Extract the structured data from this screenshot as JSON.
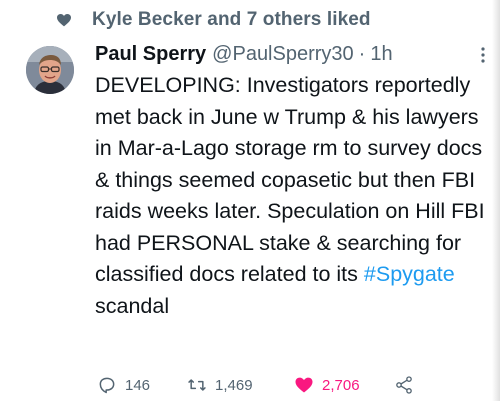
{
  "social_context": {
    "text": "Kyle Becker and 7 others liked",
    "icon": "heart-icon"
  },
  "author": {
    "display_name": "Paul Sperry",
    "handle": "@PaulSperry30",
    "separator": "·",
    "time": "1h"
  },
  "tweet": {
    "text_before_hashtag": "DEVELOPING: Investigators reportedly met back in June w Trump & his lawyers in Mar-a-Lago storage rm to survey docs & things seemed copasetic but then FBI raids weeks later. Speculation on Hill FBI had PERSONAL stake & searching for classified docs related to its ",
    "hashtag": "#Spygate",
    "text_after_hashtag": " scandal"
  },
  "actions": {
    "reply_count": "146",
    "retweet_count": "1,469",
    "like_count": "2,706"
  },
  "colors": {
    "like_pink": "#f91880",
    "link_blue": "#1d9bf0",
    "secondary_gray": "#536471",
    "text_primary": "#0f1419"
  }
}
